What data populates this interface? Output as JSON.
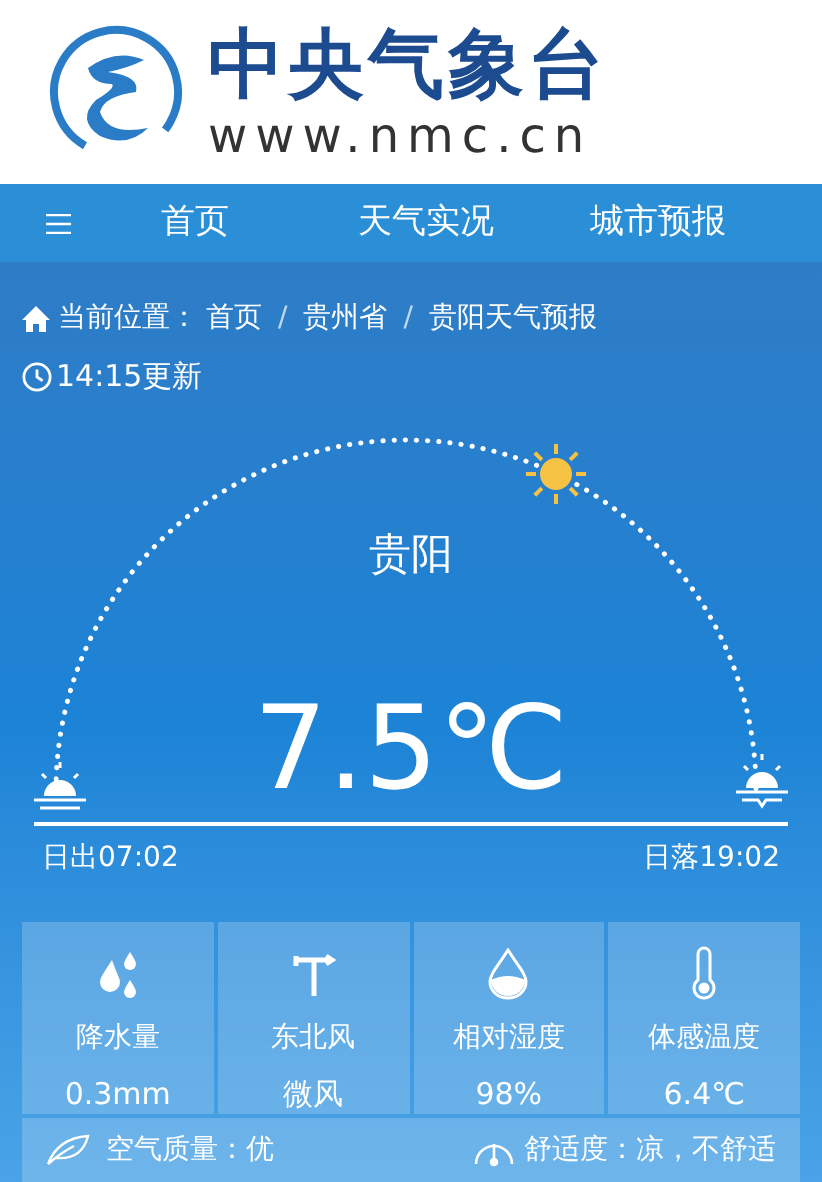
{
  "header": {
    "title": "中央气象台",
    "url": "www.nmc.cn"
  },
  "nav": {
    "items": [
      {
        "label": "首页"
      },
      {
        "label": "天气实况"
      },
      {
        "label": "城市预报"
      }
    ]
  },
  "breadcrumb": {
    "prefix": "当前位置：",
    "items": [
      "首页",
      "贵州省",
      "贵阳天气预报"
    ],
    "separator": "/"
  },
  "updated": "14:15更新",
  "city": "贵阳",
  "temperature": "7.5℃",
  "sun": {
    "sunrise": "日出07:02",
    "sunset": "日落19:02"
  },
  "stats": [
    {
      "kind": "rain",
      "label": "降水量",
      "value": "0.3mm"
    },
    {
      "kind": "wind",
      "label": "东北风",
      "value": "微风"
    },
    {
      "kind": "humidity",
      "label": "相对湿度",
      "value": "98%"
    },
    {
      "kind": "feels",
      "label": "体感温度",
      "value": "6.4℃"
    }
  ],
  "footer": {
    "air": "空气质量：优",
    "comfort": "舒适度：凉，不舒适"
  }
}
